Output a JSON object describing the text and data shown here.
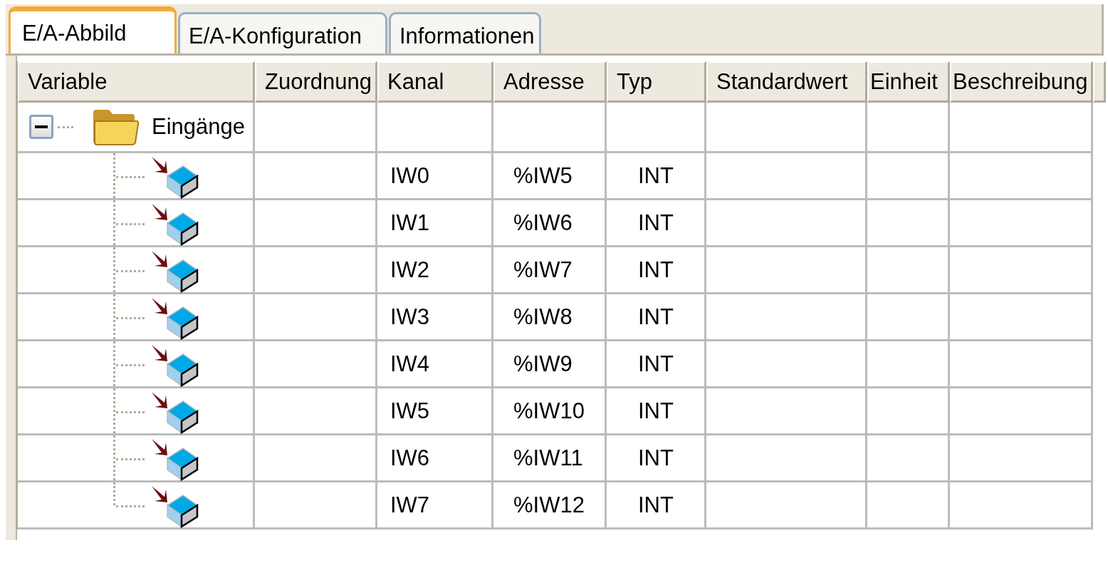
{
  "tabs": [
    {
      "label": "E/A-Abbild",
      "selected": true
    },
    {
      "label": "E/A-Konfiguration",
      "selected": false
    },
    {
      "label": "Informationen",
      "selected": false
    }
  ],
  "table": {
    "columns": [
      "Variable",
      "Zuordnung",
      "Kanal",
      "Adresse",
      "Typ",
      "Standardwert",
      "Einheit",
      "Beschreibung"
    ],
    "tree": {
      "label": "Eingänge",
      "expanded": true,
      "children": [
        {
          "kanal": "IW0",
          "adresse": "%IW5",
          "typ": "INT"
        },
        {
          "kanal": "IW1",
          "adresse": "%IW6",
          "typ": "INT"
        },
        {
          "kanal": "IW2",
          "adresse": "%IW7",
          "typ": "INT"
        },
        {
          "kanal": "IW3",
          "adresse": "%IW8",
          "typ": "INT"
        },
        {
          "kanal": "IW4",
          "adresse": "%IW9",
          "typ": "INT"
        },
        {
          "kanal": "IW5",
          "adresse": "%IW10",
          "typ": "INT"
        },
        {
          "kanal": "IW6",
          "adresse": "%IW11",
          "typ": "INT"
        },
        {
          "kanal": "IW7",
          "adresse": "%IW12",
          "typ": "INT"
        }
      ]
    }
  }
}
